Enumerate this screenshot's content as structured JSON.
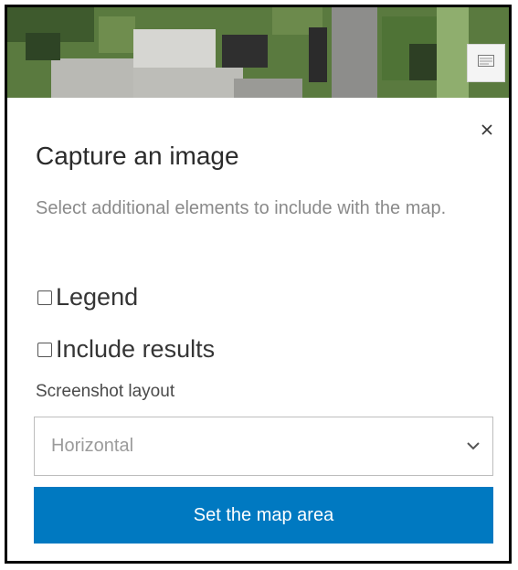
{
  "map": {
    "button_icon": "screenshot-layout-icon"
  },
  "dialog": {
    "close_icon": "close-icon",
    "title": "Capture an image",
    "description": "Select additional elements to include with the map.",
    "options": [
      {
        "label": "Legend",
        "checked": false
      },
      {
        "label": "Include results",
        "checked": false
      }
    ],
    "layout": {
      "label": "Screenshot layout",
      "selected": "Horizontal",
      "chevron_icon": "chevron-down-icon"
    },
    "primary_button": {
      "label": "Set the map area",
      "color": "#0079c1"
    }
  }
}
